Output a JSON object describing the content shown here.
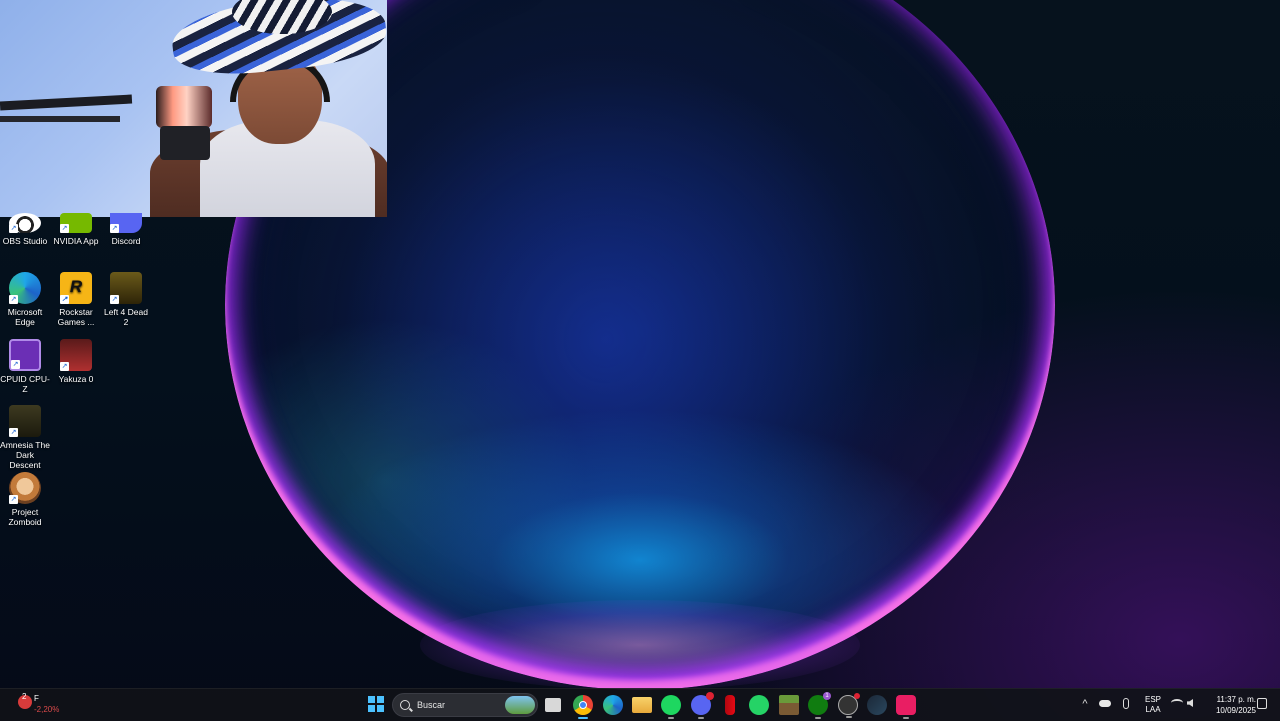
{
  "desktop": {
    "icons": [
      {
        "label": "OBS Studio",
        "icon": "obs-icon"
      },
      {
        "label": "NVIDIA App",
        "icon": "nvidia-icon"
      },
      {
        "label": "Discord",
        "icon": "discord-icon"
      },
      {
        "label": "Microsoft Edge",
        "icon": "edge-icon"
      },
      {
        "label": "Rockstar Games ...",
        "icon": "rockstar-icon"
      },
      {
        "label": "Left 4 Dead 2",
        "icon": "left4dead2-icon"
      },
      {
        "label": "CPUID CPU-Z",
        "icon": "cpuz-icon"
      },
      {
        "label": "Yakuza 0",
        "icon": "yakuza0-icon"
      },
      {
        "label": "Amnesia The Dark Descent",
        "icon": "amnesia-icon"
      },
      {
        "label": "Project Zomboid",
        "icon": "zomboid-icon"
      }
    ]
  },
  "taskbar": {
    "weather": {
      "badge": "2",
      "unit": "F",
      "change": "-2,20%"
    },
    "search": {
      "placeholder": "Buscar"
    },
    "apps": [
      {
        "name": "task-view",
        "icon": "task-view-icon"
      },
      {
        "name": "chrome",
        "icon": "chrome-icon"
      },
      {
        "name": "edge",
        "icon": "edge-icon"
      },
      {
        "name": "file-explorer",
        "icon": "folder-icon"
      },
      {
        "name": "spotify",
        "icon": "spotify-icon"
      },
      {
        "name": "discord",
        "icon": "discord-icon"
      },
      {
        "name": "netflix",
        "icon": "netflix-icon"
      },
      {
        "name": "whatsapp",
        "icon": "whatsapp-icon"
      },
      {
        "name": "minecraft",
        "icon": "minecraft-icon"
      },
      {
        "name": "xbox",
        "icon": "xbox-icon",
        "badge": "1"
      },
      {
        "name": "obs",
        "icon": "obs-icon"
      },
      {
        "name": "steam",
        "icon": "steam-icon"
      },
      {
        "name": "tiktok",
        "icon": "tiktok-icon"
      }
    ],
    "tray": {
      "language_line1": "ESP",
      "language_line2": "LAA",
      "time": "11:37 p. m.",
      "date": "10/09/2025"
    }
  },
  "colors": {
    "accent": "#4cc2ff",
    "taskbar_bg": "#101218"
  }
}
